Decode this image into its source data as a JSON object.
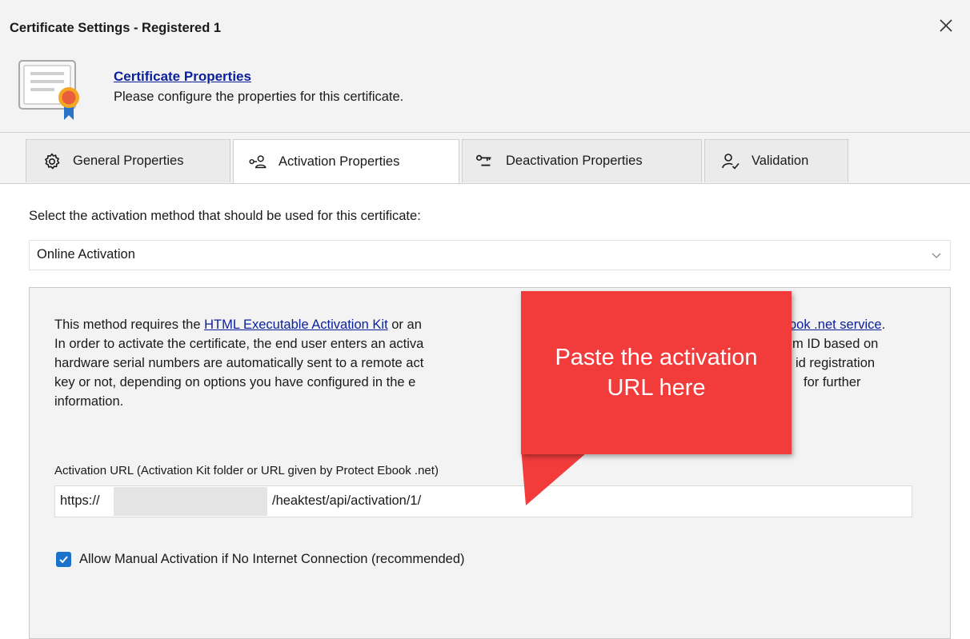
{
  "window": {
    "title": "Certificate Settings - Registered 1"
  },
  "header": {
    "link_title": "Certificate Properties",
    "description": "Please configure the properties for this certificate."
  },
  "tabs": [
    {
      "label": "General Properties",
      "icon": "gear-icon",
      "active": false
    },
    {
      "label": "Activation Properties",
      "icon": "activation-key-user-icon",
      "active": true
    },
    {
      "label": "Deactivation Properties",
      "icon": "key-icon",
      "active": false
    },
    {
      "label": "Validation",
      "icon": "user-check-icon",
      "active": false
    }
  ],
  "content": {
    "select_label": "Select the activation method that should be used for this certificate:",
    "method_value": "Online Activation",
    "description": {
      "line1_a": "This method requires the ",
      "line1_link1": "HTML Executable Activation Kit",
      "line1_b": " or an",
      "line1_link2": "ook .net service",
      "line1_end": ".",
      "line2_a": "In order to activate the certificate, the end user enters an activa",
      "line2_b": "m ID based on",
      "line3_a": "hardware serial numbers are automatically sent to a remote act",
      "line3_b": "id registration",
      "line4_a": "key or not, depending on options you have configured in the e",
      "line4_b": "for further",
      "line5": "information."
    },
    "url_label": "Activation URL (Activation Kit folder or URL given by Protect Ebook .net)",
    "url_prefix": "https://",
    "url_suffix": "/heaktest/api/activation/1/",
    "manual_activation_label": "Allow Manual Activation if No Internet Connection (recommended)",
    "manual_activation_checked": true
  },
  "callout": {
    "line1": "Paste the activation",
    "line2": "URL here",
    "color": "#f23c3c"
  }
}
